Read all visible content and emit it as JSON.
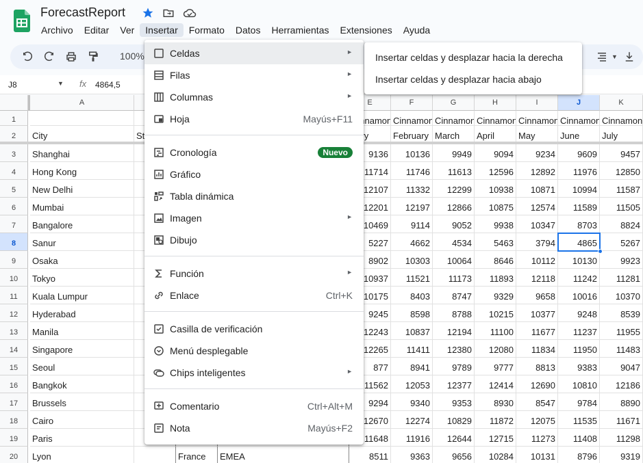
{
  "title": "ForecastReport",
  "menubar": [
    "Archivo",
    "Editar",
    "Ver",
    "Insertar",
    "Formato",
    "Datos",
    "Herramientas",
    "Extensiones",
    "Ayuda"
  ],
  "toolbar": {
    "zoom": "100%"
  },
  "formula": {
    "cell_ref": "J8",
    "value": "4864,5"
  },
  "columns": [
    "A",
    "E",
    "F",
    "G",
    "H",
    "I",
    "J",
    "K"
  ],
  "rows": [
    {
      "n": "1",
      "city": "",
      "vals": [
        "Cinnamon",
        "Cinnamon",
        "Cinnamon",
        "Cinnamon",
        "Cinnamon",
        "Cinnamon",
        "Cinnamon"
      ]
    },
    {
      "n": "2",
      "city": "City",
      "vals": [
        "uary",
        "February",
        "March",
        "April",
        "May",
        "June",
        "July"
      ]
    },
    {
      "n": "3",
      "city": "Shanghai",
      "vals": [
        "9136",
        "10136",
        "9949",
        "9094",
        "9234",
        "9609",
        "9457"
      ]
    },
    {
      "n": "4",
      "city": "Hong Kong",
      "vals": [
        "11714",
        "11746",
        "11613",
        "12596",
        "12892",
        "11976",
        "12850"
      ]
    },
    {
      "n": "5",
      "city": "New Delhi",
      "vals": [
        "12107",
        "11332",
        "12299",
        "10938",
        "10871",
        "10994",
        "11587"
      ]
    },
    {
      "n": "6",
      "city": "Mumbai",
      "vals": [
        "12201",
        "12197",
        "12866",
        "10875",
        "12574",
        "11589",
        "11505"
      ]
    },
    {
      "n": "7",
      "city": "Bangalore",
      "vals": [
        "10469",
        "9114",
        "9052",
        "9938",
        "10347",
        "8703",
        "8824"
      ]
    },
    {
      "n": "8",
      "city": "Sanur",
      "vals": [
        "5227",
        "4662",
        "4534",
        "5463",
        "3794",
        "4865",
        "5267"
      ]
    },
    {
      "n": "9",
      "city": "Osaka",
      "vals": [
        "8902",
        "10303",
        "10064",
        "8646",
        "10112",
        "10130",
        "9923"
      ]
    },
    {
      "n": "10",
      "city": "Tokyo",
      "vals": [
        "10937",
        "11521",
        "11173",
        "11893",
        "12118",
        "11242",
        "11281"
      ]
    },
    {
      "n": "11",
      "city": "Kuala Lumpur",
      "vals": [
        "10175",
        "8403",
        "8747",
        "9329",
        "9658",
        "10016",
        "10370"
      ]
    },
    {
      "n": "12",
      "city": "Hyderabad",
      "vals": [
        "9245",
        "8598",
        "8788",
        "10215",
        "10377",
        "9248",
        "8539"
      ]
    },
    {
      "n": "13",
      "city": "Manila",
      "vals": [
        "12243",
        "10837",
        "12194",
        "11100",
        "11677",
        "11237",
        "11955"
      ]
    },
    {
      "n": "14",
      "city": "Singapore",
      "vals": [
        "12265",
        "11411",
        "12380",
        "12080",
        "11834",
        "11950",
        "11483"
      ]
    },
    {
      "n": "15",
      "city": "Seoul",
      "vals": [
        "877",
        "8941",
        "9789",
        "9777",
        "8813",
        "9383",
        "9047"
      ]
    },
    {
      "n": "16",
      "city": "Bangkok",
      "vals": [
        "11562",
        "12053",
        "12377",
        "12414",
        "12690",
        "10810",
        "12186"
      ]
    },
    {
      "n": "17",
      "city": "Brussels",
      "vals": [
        "9294",
        "9340",
        "9353",
        "8930",
        "8547",
        "9784",
        "8890"
      ]
    },
    {
      "n": "18",
      "city": "Cairo",
      "vals": [
        "12670",
        "12274",
        "10829",
        "11872",
        "12075",
        "11535",
        "11671"
      ]
    },
    {
      "n": "19",
      "city": "Paris",
      "vals": [
        "11648",
        "11916",
        "12644",
        "12715",
        "11273",
        "11408",
        "11298"
      ]
    },
    {
      "n": "20",
      "city": "Lyon",
      "vals": [
        "8511",
        "9363",
        "9656",
        "10284",
        "10131",
        "8796",
        "9319"
      ]
    }
  ],
  "row2_partial_b": "St",
  "row20_extra": {
    "country": "France",
    "region": "EMEA"
  },
  "menu": {
    "items": [
      {
        "label": "Celdas",
        "icon": "cell-icon",
        "submenu": true
      },
      {
        "label": "Filas",
        "icon": "rows-icon",
        "submenu": true
      },
      {
        "label": "Columnas",
        "icon": "columns-icon",
        "submenu": true
      },
      {
        "label": "Hoja",
        "icon": "sheet-icon",
        "shortcut": "Mayús+F11"
      },
      {
        "label": "Cronología",
        "icon": "timeline-icon",
        "badge": "Nuevo"
      },
      {
        "label": "Gráfico",
        "icon": "chart-icon"
      },
      {
        "label": "Tabla dinámica",
        "icon": "pivot-table-icon"
      },
      {
        "label": "Imagen",
        "icon": "image-icon",
        "submenu": true
      },
      {
        "label": "Dibujo",
        "icon": "drawing-icon"
      },
      {
        "label": "Función",
        "icon": "sigma-icon",
        "submenu": true
      },
      {
        "label": "Enlace",
        "icon": "link-icon",
        "shortcut": "Ctrl+K"
      },
      {
        "label": "Casilla de verificación",
        "icon": "checkbox-icon"
      },
      {
        "label": "Menú desplegable",
        "icon": "dropdown-icon"
      },
      {
        "label": "Chips inteligentes",
        "icon": "smart-chip-icon",
        "submenu": true
      },
      {
        "label": "Comentario",
        "icon": "comment-icon",
        "shortcut": "Ctrl+Alt+M"
      },
      {
        "label": "Nota",
        "icon": "note-icon",
        "shortcut": "Mayús+F2"
      }
    ]
  },
  "submenu": {
    "items": [
      "Insertar celdas y desplazar hacia la derecha",
      "Insertar celdas y desplazar hacia abajo"
    ]
  },
  "colors": {
    "accent": "#1a73e8",
    "badge": "#188038",
    "selected_header": "#d3e3fd"
  }
}
